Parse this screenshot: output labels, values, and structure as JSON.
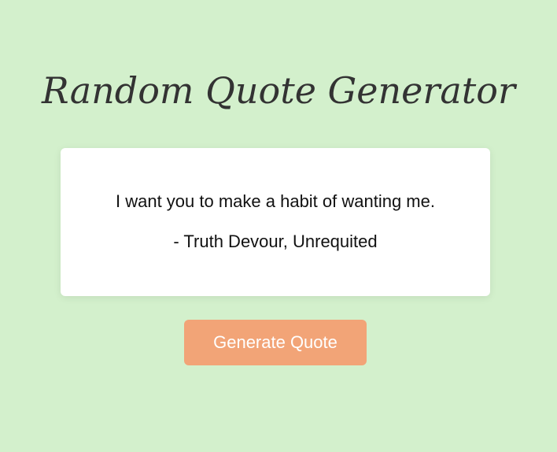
{
  "page": {
    "title": "Random Quote Generator",
    "background_color": "#d3f0cc"
  },
  "quote": {
    "text": "I want you to make a habit of wanting me.",
    "attribution": "- Truth Devour, Unrequited",
    "card_color": "#ffffff"
  },
  "generate_button": {
    "label": "Generate Quote",
    "color": "#f2a477"
  }
}
